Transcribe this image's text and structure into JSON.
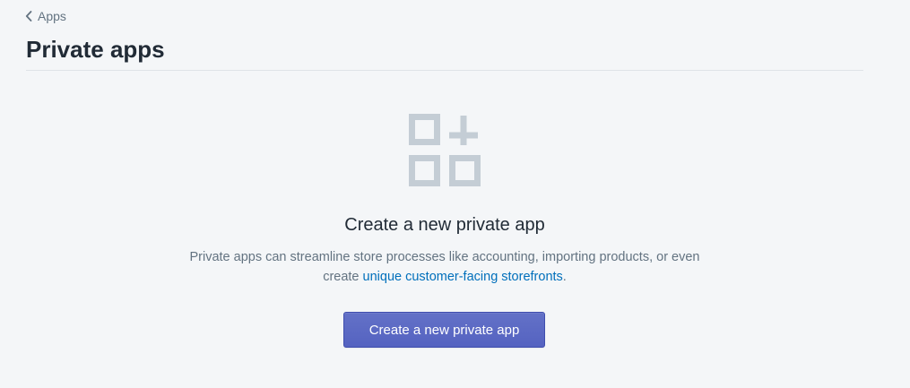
{
  "breadcrumb": {
    "label": "Apps",
    "icon": "chevron-left-icon"
  },
  "page": {
    "title": "Private apps"
  },
  "empty_state": {
    "icon": "apps-add-icon",
    "heading": "Create a new private app",
    "description_prefix": "Private apps can streamline store processes like accounting, importing products, or even create ",
    "link_text": "unique customer-facing storefronts",
    "description_suffix": ".",
    "button_label": "Create a new private app"
  },
  "colors": {
    "background": "#f4f6f8",
    "link": "#006fbb",
    "primary_button": "#5c6ac4",
    "icon": "#c4cdd5"
  }
}
